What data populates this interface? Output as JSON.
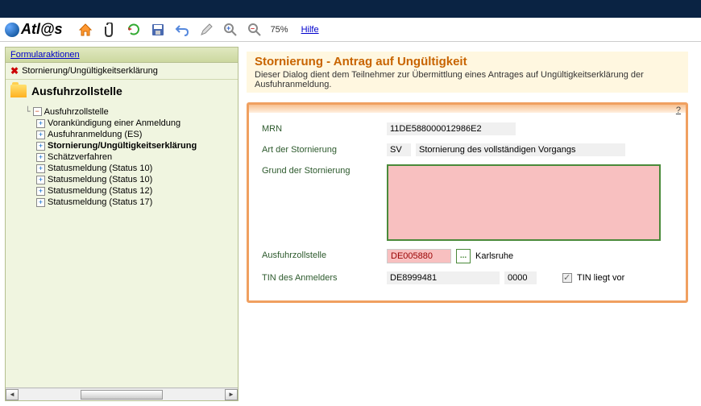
{
  "logo_text": "Atl@s",
  "zoom": "75%",
  "help": "Hilfe ",
  "sidebar": {
    "header": "Formularaktionen",
    "action": "Stornierung/Ungültigkeitserklärung",
    "section_title": "Ausfuhrzollstelle",
    "tree_root": "Ausfuhrzollstelle",
    "items": [
      "Vorankündigung einer Anmeldung",
      "Ausfuhranmeldung  (ES)",
      "Stornierung/Ungültigkeitserklärung",
      "Schätzverfahren",
      "Statusmeldung (Status 10)",
      "Statusmeldung (Status 10)",
      "Statusmeldung (Status 12)",
      "Statusmeldung (Status 17)"
    ]
  },
  "content": {
    "title": "Stornierung - Antrag auf Ungültigkeit",
    "desc": "Dieser Dialog dient dem Teilnehmer zur Übermittlung eines Antrages auf Ungültigkeitserklärung der Ausfuhranmeldung.",
    "help_q": "?"
  },
  "form": {
    "mrn_label": "MRN",
    "mrn_value": "11DE588000012986E2",
    "art_label": "Art der Stornierung",
    "art_code": "SV",
    "art_text": "Stornierung des vollständigen Vorgangs",
    "grund_label": "Grund der Stornierung",
    "grund_value": "",
    "zollstelle_label": "Ausfuhrzollstelle",
    "zollstelle_code": "DE005880",
    "zollstelle_name": "Karlsruhe",
    "lookup_dots": "...",
    "tin_label": "TIN des Anmelders",
    "tin_value": "DE8999481",
    "tin_sub": "0000",
    "tin_chk_label": "TIN liegt vor"
  }
}
